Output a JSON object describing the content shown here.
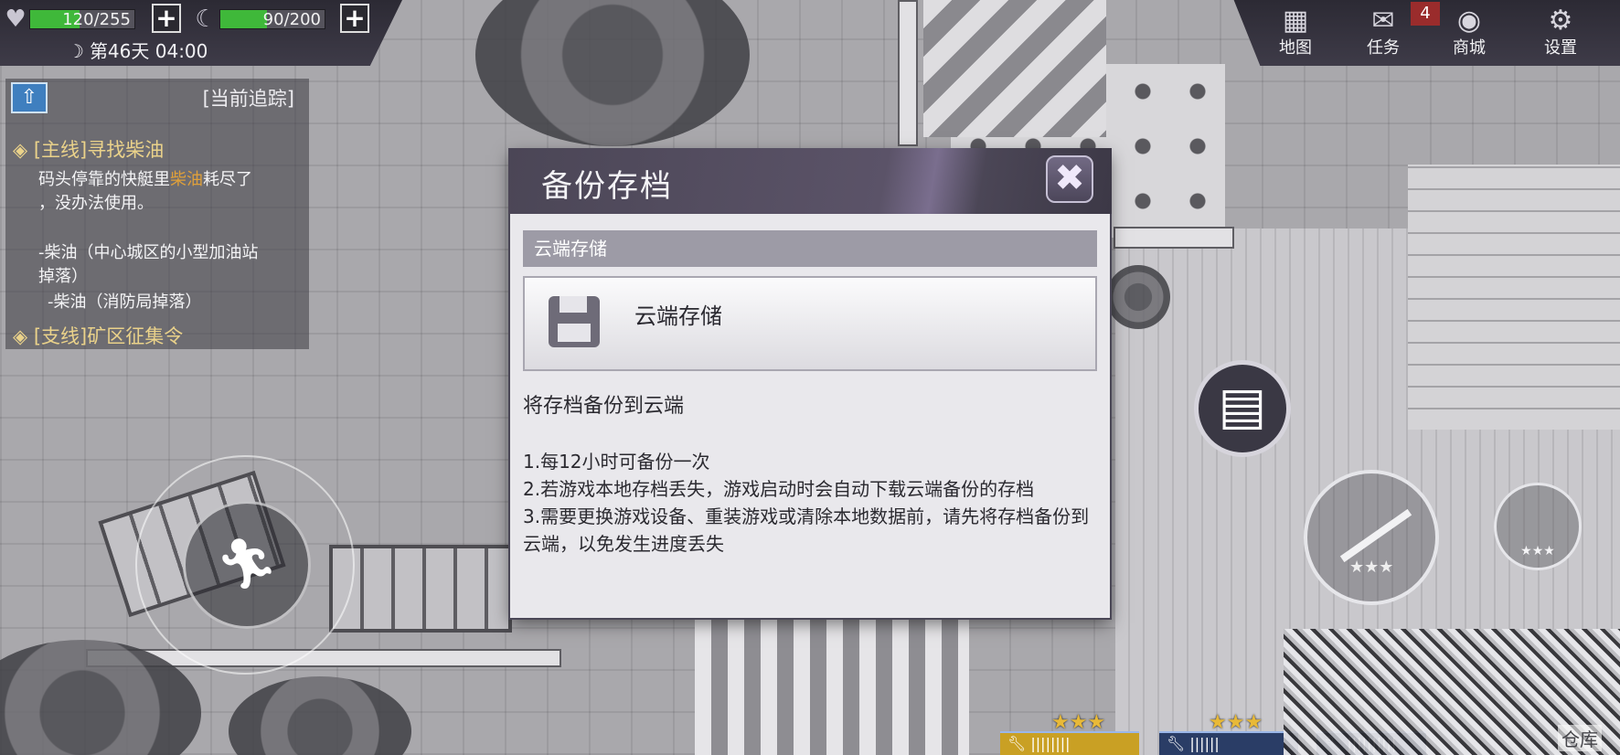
{
  "hud": {
    "health": {
      "value": "120/255",
      "fraction": 0.47
    },
    "hunger": {
      "value": "90/200",
      "fraction": 0.45
    },
    "day_label": "第46天 04:00"
  },
  "menu": {
    "map": "地图",
    "tasks": "任务",
    "tasks_badge": "4",
    "shop": "商城",
    "settings": "设置"
  },
  "tracker": {
    "header": "[当前追踪]",
    "main_quest": "[主线]寻找柴油",
    "main_desc_1_pre": "码头停靠的快艇里",
    "main_desc_1_hl": "柴油",
    "main_desc_1_post": "耗尽了",
    "main_desc_2": "，没办法使用。",
    "drop_1a": "-柴油（中心城区的小型加油站",
    "drop_1b": "掉落）",
    "drop_2": "-柴油（消防局掉落）",
    "side_quest": "[支线]矿区征集令"
  },
  "modal": {
    "title": "备份存档",
    "close_icon": "✖",
    "section": "云端存储",
    "cloud_button": "云端存储",
    "description": "将存档备份到云端",
    "rule_1": "1.每12小时可备份一次",
    "rule_2": "2.若游戏本地存档丢失，游戏启动时会自动下载云端备份的存档",
    "rule_3": "3.需要更换游戏设备、重装游戏或清除本地数据前，请先将存档备份到云端，以免发生进度丢失"
  },
  "hotbar": {
    "stars_left": "★★★",
    "stars_mid": "★★★",
    "attack_stars": "★★★",
    "small_stars": "★★★",
    "warehouse": "仓库"
  },
  "colors": {
    "bar_green": "#3fb83a",
    "accent_purple": "#5b5368",
    "badge_red": "#9a2c2c"
  }
}
